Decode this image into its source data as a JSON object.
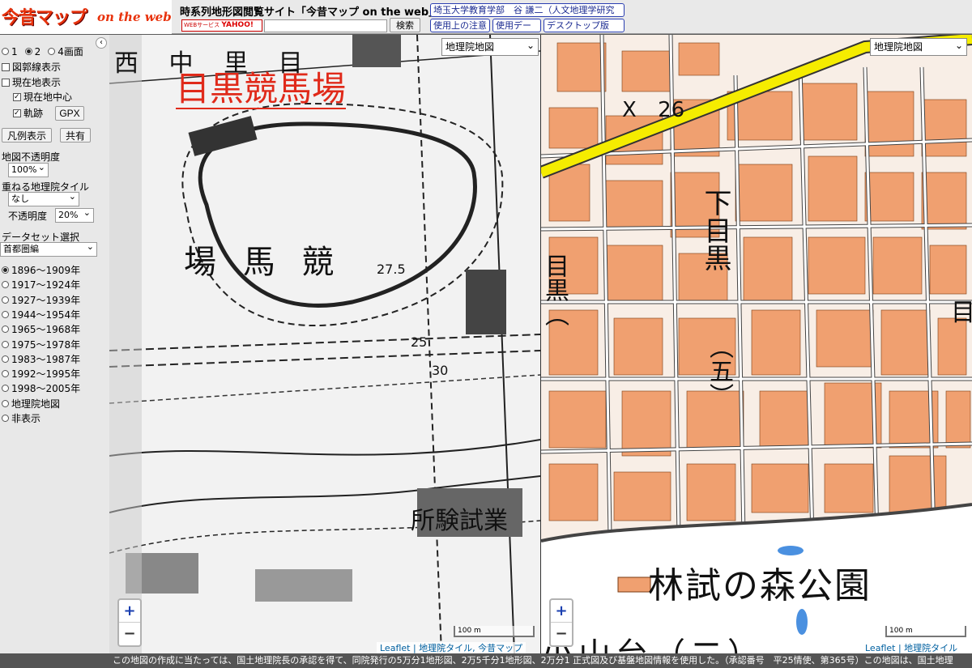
{
  "header": {
    "logo_kanji": "今昔マップ",
    "logo_web": "on the web",
    "site_title": "時系列地形図閲覧サイト「今昔マップ on the web」",
    "badge_webservice": "WEBサービス",
    "badge_yahoo": "YAHOO!",
    "search_value": "",
    "search_button": "検索",
    "author_link": "埼玉大学教育学部　谷 謙二（人文地理学研究",
    "caution_button": "使用上の注意",
    "usage_button": "使用デー",
    "desktop_button": "デスクトップ版"
  },
  "sidebar": {
    "collapse_icon": "‹",
    "layout_options": [
      {
        "label": "1",
        "selected": false
      },
      {
        "label": "2",
        "selected": true
      },
      {
        "label": "4画面",
        "selected": false
      }
    ],
    "checkbox_grid": "図郭線表示",
    "checkbox_current": "現在地表示",
    "checkbox_center": "現在地中心",
    "checkbox_track": "軌跡",
    "gpx_button": "GPX",
    "legend_button": "凡例表示",
    "share_button": "共有",
    "opacity_label": "地図不透明度",
    "opacity_value": "100%",
    "overlay_label": "重ねる地理院タイル",
    "overlay_value": "なし",
    "overlay_opacity_label": "不透明度",
    "overlay_opacity_value": "20%",
    "dataset_label": "データセット選択",
    "dataset_value": "首都圏編",
    "periods": [
      {
        "label": "1896〜1909年",
        "selected": true
      },
      {
        "label": "1917〜1924年",
        "selected": false
      },
      {
        "label": "1927〜1939年",
        "selected": false
      },
      {
        "label": "1944〜1954年",
        "selected": false
      },
      {
        "label": "1965〜1968年",
        "selected": false
      },
      {
        "label": "1975〜1978年",
        "selected": false
      },
      {
        "label": "1983〜1987年",
        "selected": false
      },
      {
        "label": "1992〜1995年",
        "selected": false
      },
      {
        "label": "1998〜2005年",
        "selected": false
      },
      {
        "label": "地理院地図",
        "selected": false
      },
      {
        "label": "非表示",
        "selected": false
      }
    ]
  },
  "left_map": {
    "select_value": "地理院地図",
    "annotation": "目黒競馬場",
    "label_keibajo": "場 馬 競",
    "label_top": "西 中 里 目",
    "label_bottom": "所験試業",
    "contour_275": "27.5",
    "contour_25": "25",
    "contour_30": "30",
    "zoom_in": "+",
    "zoom_out": "−",
    "scale": "100 m",
    "attribution": "Leaflet | 地理院タイル, 今昔マップ"
  },
  "right_map": {
    "select_value": "地理院地図",
    "label_shimomeguro": "下目黒",
    "label_go": "（五）",
    "label_park": "林試の森公園",
    "label_bottom": "小山台（二）",
    "label_left": "目黒（",
    "label_right": "目",
    "road_number": "26",
    "zoom_in": "+",
    "zoom_out": "−",
    "scale": "100 m",
    "attribution": "Leaflet | 地理院タイル"
  },
  "footer": {
    "text": "この地図の作成に当たっては、国土地理院長の承認を得て、同院発行の5万分1地形図、2万5千分1地形図、2万分1 正式図及び基盤地図情報を使用した。（承認番号　平25情使、第365号）この地図は、国土地理"
  },
  "colors": {
    "building": "#f0a070",
    "road_main": "#f5ec00",
    "logo_red": "#e8320c",
    "annotation_red": "#e02a1a"
  }
}
